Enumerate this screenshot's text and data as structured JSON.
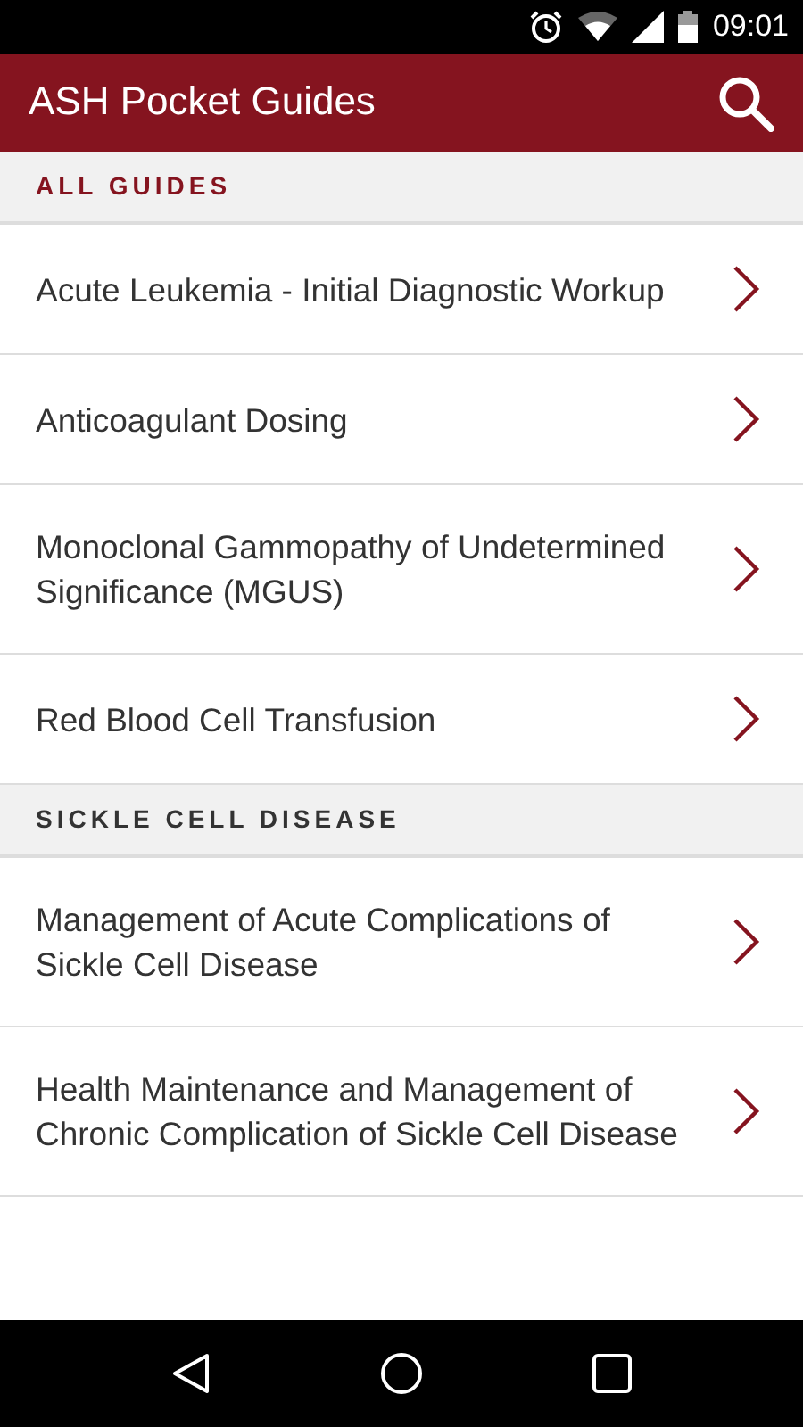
{
  "status_bar": {
    "time": "09:01"
  },
  "app_bar": {
    "title": "ASH Pocket Guides"
  },
  "sections": [
    {
      "title": "ALL GUIDES",
      "color": "#85141f",
      "items": [
        {
          "label": "Acute Leukemia - Initial Diagnostic Workup"
        },
        {
          "label": "Anticoagulant Dosing"
        },
        {
          "label": "Monoclonal Gammopathy of Undetermined Significance (MGUS)"
        },
        {
          "label": "Red Blood Cell Transfusion"
        }
      ]
    },
    {
      "title": "SICKLE CELL DISEASE",
      "color": "#333333",
      "items": [
        {
          "label": "Management of Acute Complications of Sickle Cell Disease"
        },
        {
          "label": "Health Maintenance and Management of Chronic Complication of Sickle Cell Disease"
        }
      ]
    }
  ]
}
